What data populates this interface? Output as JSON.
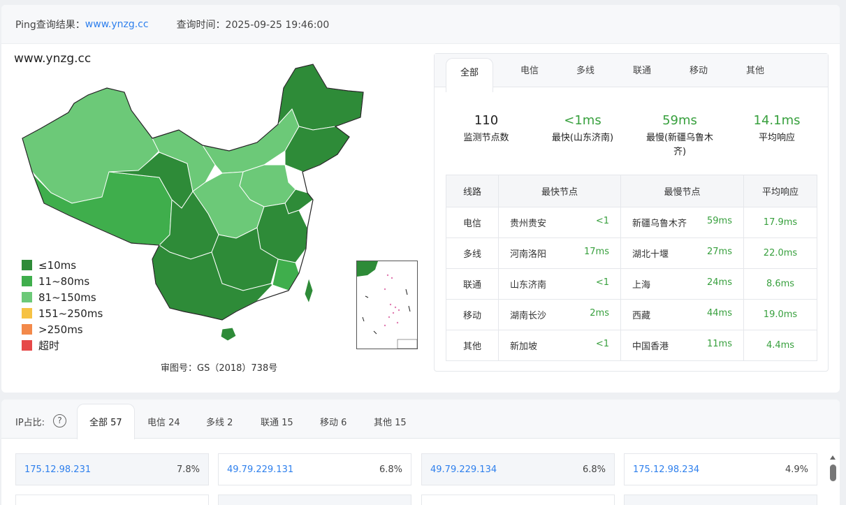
{
  "header": {
    "result_label": "Ping查询结果：",
    "domain_link": "www.ynzg.cc",
    "time_label": "查询时间：2025-09-25 19:46:00"
  },
  "map": {
    "title": "www.ynzg.cc",
    "approval": "审图号：GS（2018）738号",
    "legend": [
      {
        "label": "≤10ms",
        "color": "#2e8b38"
      },
      {
        "label": "11~80ms",
        "color": "#3fae4c"
      },
      {
        "label": "81~150ms",
        "color": "#6cc978"
      },
      {
        "label": "151~250ms",
        "color": "#f6c244"
      },
      {
        "label": ">250ms",
        "color": "#f3894a"
      },
      {
        "label": "超时",
        "color": "#e64848"
      }
    ]
  },
  "panel": {
    "tabs": [
      "全部",
      "电信",
      "多线",
      "联通",
      "移动",
      "其他"
    ],
    "active_tab": "全部",
    "stats": [
      {
        "value": "110",
        "label": "监测节点数"
      },
      {
        "value": "<1ms",
        "label": "最快(山东济南)"
      },
      {
        "value": "59ms",
        "label": "最慢(新疆乌鲁木齐)"
      },
      {
        "value": "14.1ms",
        "label": "平均响应"
      }
    ],
    "table": {
      "headers": [
        "线路",
        "最快节点",
        "最慢节点",
        "平均响应"
      ],
      "rows": [
        {
          "line": "电信",
          "fast_node": "贵州贵安",
          "fast_ms": "<1",
          "slow_node": "新疆乌鲁木齐",
          "slow_ms": "59ms",
          "avg": "17.9ms"
        },
        {
          "line": "多线",
          "fast_node": "河南洛阳",
          "fast_ms": "17ms",
          "slow_node": "湖北十堰",
          "slow_ms": "27ms",
          "avg": "22.0ms"
        },
        {
          "line": "联通",
          "fast_node": "山东济南",
          "fast_ms": "<1",
          "slow_node": "上海",
          "slow_ms": "24ms",
          "avg": "8.6ms"
        },
        {
          "line": "移动",
          "fast_node": "湖南长沙",
          "fast_ms": "2ms",
          "slow_node": "西藏",
          "slow_ms": "44ms",
          "avg": "19.0ms"
        },
        {
          "line": "其他",
          "fast_node": "新加坡",
          "fast_ms": "<1",
          "slow_node": "中国香港",
          "slow_ms": "11ms",
          "avg": "4.4ms"
        }
      ]
    }
  },
  "ip": {
    "label": "IP占比:",
    "help_icon": "?",
    "tabs": [
      "全部 57",
      "电信 24",
      "多线 2",
      "联通 15",
      "移动 6",
      "其他 15"
    ],
    "cards": [
      {
        "ip": "175.12.98.231",
        "pct": "7.8%"
      },
      {
        "ip": "49.79.229.131",
        "pct": "6.8%"
      },
      {
        "ip": "49.79.229.134",
        "pct": "6.8%"
      },
      {
        "ip": "175.12.98.234",
        "pct": "4.9%"
      }
    ]
  }
}
